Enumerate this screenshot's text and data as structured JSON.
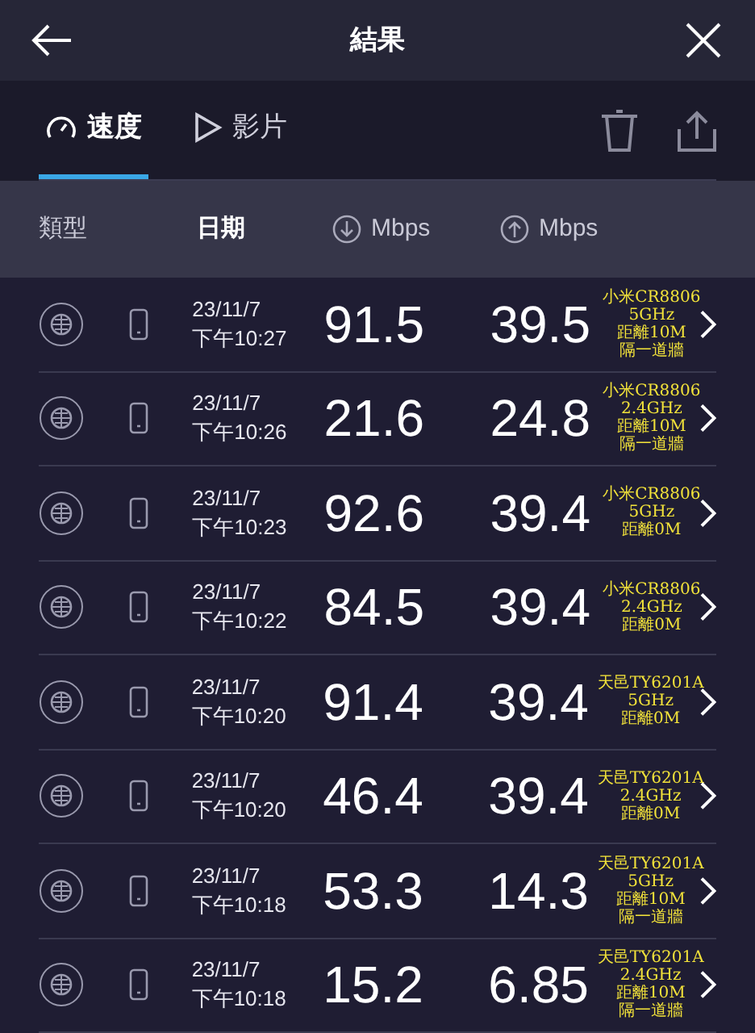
{
  "header": {
    "title": "結果"
  },
  "tabs": [
    {
      "label": "速度",
      "kind": "speed",
      "selected": true
    },
    {
      "label": "影片",
      "kind": "video",
      "selected": false
    }
  ],
  "columns": [
    "類型",
    "日期",
    "Mbps",
    "Mbps"
  ],
  "rows": [
    {
      "date": "23/11/7",
      "time": "下午10:27",
      "download": "91.5",
      "upload": "39.5",
      "note": [
        "小米CR8806",
        "5GHz",
        "距離10M",
        "隔一道牆"
      ]
    },
    {
      "date": "23/11/7",
      "time": "下午10:26",
      "download": "21.6",
      "upload": "24.8",
      "note": [
        "小米CR8806",
        "2.4GHz",
        "距離10M",
        "隔一道牆"
      ]
    },
    {
      "date": "23/11/7",
      "time": "下午10:23",
      "download": "92.6",
      "upload": "39.4",
      "note": [
        "小米CR8806",
        "5GHz",
        "距離0M"
      ]
    },
    {
      "date": "23/11/7",
      "time": "下午10:22",
      "download": "84.5",
      "upload": "39.4",
      "note": [
        "小米CR8806",
        "2.4GHz",
        "距離0M"
      ]
    },
    {
      "date": "23/11/7",
      "time": "下午10:20",
      "download": "91.4",
      "upload": "39.4",
      "note": [
        "天邑TY6201A",
        "5GHz",
        "距離0M"
      ]
    },
    {
      "date": "23/11/7",
      "time": "下午10:20",
      "download": "46.4",
      "upload": "39.4",
      "note": [
        "天邑TY6201A",
        "2.4GHz",
        "距離0M"
      ]
    },
    {
      "date": "23/11/7",
      "time": "下午10:18",
      "download": "53.3",
      "upload": "14.3",
      "note": [
        "天邑TY6201A",
        "5GHz",
        "距離10M",
        "隔一道牆"
      ]
    },
    {
      "date": "23/11/7",
      "time": "下午10:18",
      "download": "15.2",
      "upload": "6.85",
      "note": [
        "天邑TY6201A",
        "2.4GHz",
        "距離10M",
        "隔一道牆"
      ]
    }
  ]
}
